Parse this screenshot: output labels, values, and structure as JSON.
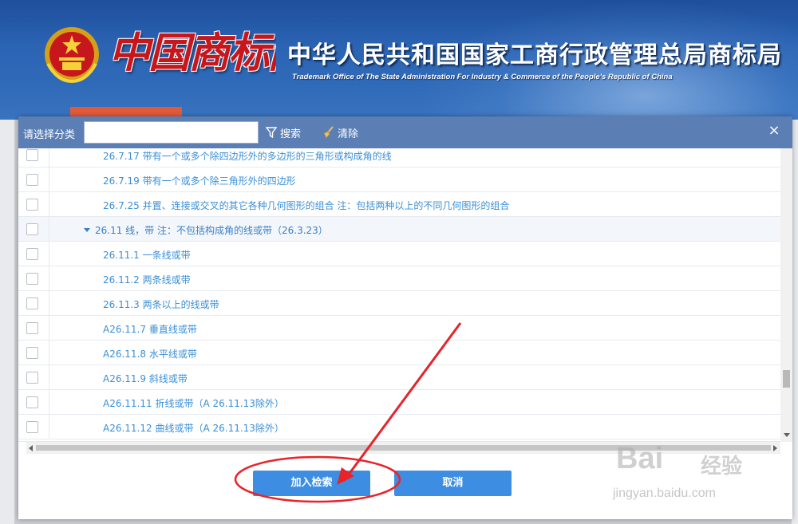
{
  "header": {
    "logo_text": "中国商标网",
    "office_title": "中华人民共和国国家工商行政管理总局商标局",
    "office_subtitle": "Trademark Office of The State Administration For Industry & Commerce of the People's Republic of China"
  },
  "dialog": {
    "filter_label": "请选择分类",
    "filter_value": "",
    "search_label": "搜索",
    "clear_label": "清除",
    "close_symbol": "×",
    "rows": [
      {
        "text": "26.7.17 带有一个或多个除四边形外的多边形的三角形或构成角的线",
        "group": false
      },
      {
        "text": "26.7.19 带有一个或多个除三角形外的四边形",
        "group": false
      },
      {
        "text": "26.7.25 并置、连接或交叉的其它各种几何图形的组合 注：包括两种以上的不同几何图形的组合",
        "group": false
      },
      {
        "text": "26.11 线，带 注：不包括构成角的线或带（26.3.23）",
        "group": true
      },
      {
        "text": "26.11.1 一条线或带",
        "group": false
      },
      {
        "text": "26.11.2 两条线或带",
        "group": false
      },
      {
        "text": "26.11.3 两条以上的线或带",
        "group": false
      },
      {
        "text": "A26.11.7 垂直线或带",
        "group": false
      },
      {
        "text": "A26.11.8 水平线或带",
        "group": false
      },
      {
        "text": "A26.11.9 斜线或带",
        "group": false
      },
      {
        "text": "A26.11.11 折线或带（A 26.11.13除外）",
        "group": false
      },
      {
        "text": "A26.11.12 曲线或带（A 26.11.13除外）",
        "group": false
      }
    ],
    "add_button": "加入检索",
    "cancel_button": "取消"
  },
  "watermark": {
    "brand": "Bai",
    "brand_cn": "经验",
    "url": "jingyan.baidu.com"
  },
  "colors": {
    "header_blue": "#2c64b4",
    "dialog_header": "#5b7fb4",
    "link_blue": "#3a8fd6",
    "button_blue": "#3d8ee3",
    "annotation_red": "#e8232a"
  }
}
